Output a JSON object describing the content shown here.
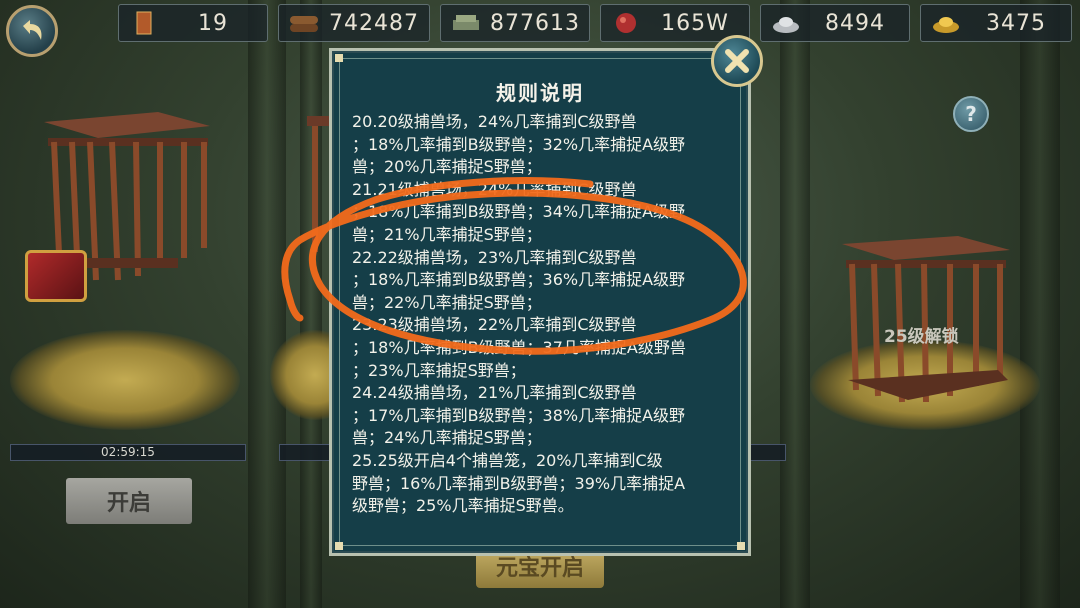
{
  "resources": [
    {
      "name": "token-icon",
      "value": "19"
    },
    {
      "name": "wood-icon",
      "value": "742487"
    },
    {
      "name": "stone-icon",
      "value": "877613"
    },
    {
      "name": "meat-icon",
      "value": "165W"
    },
    {
      "name": "silver-icon",
      "value": "8494"
    },
    {
      "name": "gold-ingot-icon",
      "value": "3475"
    }
  ],
  "help_label": "?",
  "cages": {
    "timer": "02:59:15",
    "open_label": "开启",
    "yuanbao_open_label": "元宝开启",
    "locked_label": "25级解锁"
  },
  "dialog": {
    "title": "规则说明",
    "lines": [
      "20.20级捕兽场，24%几率捕到C级野兽",
      "；18%几率捕到B级野兽；32%几率捕捉A级野",
      "兽；20%几率捕捉S野兽；",
      "21.21级捕兽场，24%几率捕到C级野兽",
      "；18%几率捕到B级野兽；34%几率捕捉A级野",
      "兽；21%几率捕捉S野兽；",
      "22.22级捕兽场，23%几率捕到C级野兽",
      "；18%几率捕到B级野兽；36%几率捕捉A级野",
      "兽；22%几率捕捉S野兽；",
      "23.23级捕兽场，22%几率捕到C级野兽",
      "；18%几率捕到B级野兽；37几率捕捉A级野兽",
      "；23%几率捕捉S野兽；",
      "24.24级捕兽场，21%几率捕到C级野兽",
      "；17%几率捕到B级野兽；38%几率捕捉A级野",
      "兽；24%几率捕捉S野兽；",
      "25.25级开启4个捕兽笼，20%几率捕到C级",
      "野兽；16%几率捕到B级野兽；39%几率捕捉A",
      "级野兽；25%几率捕捉S野兽。"
    ]
  },
  "colors": {
    "panel_bg": "#153e48",
    "annotation": "#f26a1b",
    "accent_gold": "#d8c890"
  }
}
